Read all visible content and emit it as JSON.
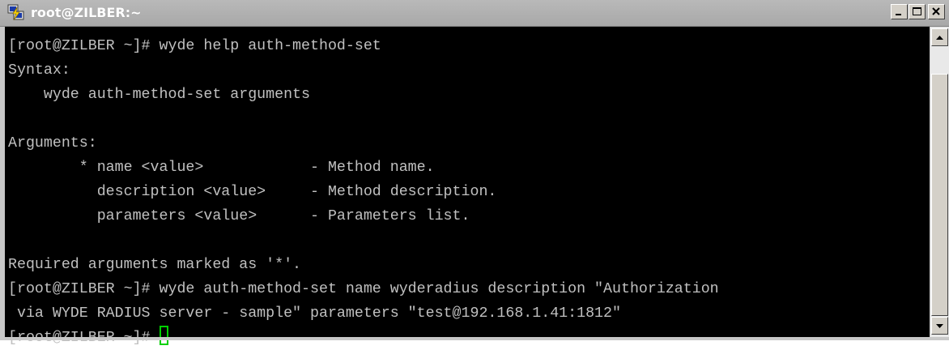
{
  "window": {
    "title": "root@ZILBER:~",
    "app_icon": "putty-icon",
    "controls": {
      "minimize": "minimize-icon",
      "maximize": "maximize-icon",
      "close": "close-icon"
    }
  },
  "terminal": {
    "background": "#000000",
    "text_color": "#c0c0c0",
    "cursor_color": "#00d000",
    "lines": [
      "[root@ZILBER ~]# wyde help auth-method-set",
      "Syntax:",
      "    wyde auth-method-set arguments",
      "",
      "Arguments:",
      "        * name <value>            - Method name.",
      "          description <value>     - Method description.",
      "          parameters <value>      - Parameters list.",
      "",
      "Required arguments marked as '*'.",
      "[root@ZILBER ~]# wyde auth-method-set name wyderadius description \"Authorization",
      " via WYDE RADIUS server - sample\" parameters \"test@192.168.1.41:1812\"",
      "[root@ZILBER ~]# "
    ]
  },
  "scrollbar": {
    "position": 1.0,
    "visible_fraction": 0.9,
    "up_icon": "arrow-up-icon",
    "down_icon": "arrow-down-icon"
  }
}
